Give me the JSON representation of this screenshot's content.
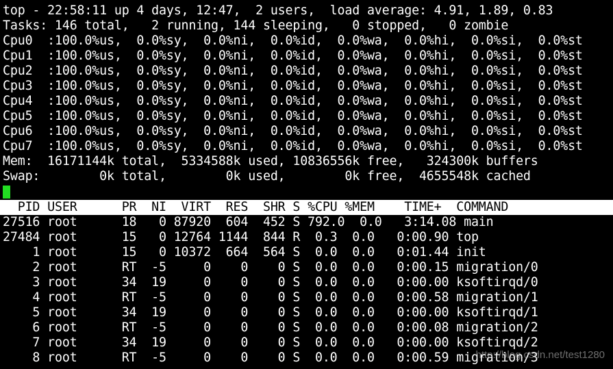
{
  "summary": {
    "uptime": "top - 22:58:11 up 4 days, 12:47,  2 users,  load average: 4.91, 1.89, 0.83",
    "tasks": "Tasks: 146 total,   2 running, 144 sleeping,   0 stopped,   0 zombie",
    "cpus": [
      "Cpu0  :100.0%us,  0.0%sy,  0.0%ni,  0.0%id,  0.0%wa,  0.0%hi,  0.0%si,  0.0%st",
      "Cpu1  :100.0%us,  0.0%sy,  0.0%ni,  0.0%id,  0.0%wa,  0.0%hi,  0.0%si,  0.0%st",
      "Cpu2  :100.0%us,  0.0%sy,  0.0%ni,  0.0%id,  0.0%wa,  0.0%hi,  0.0%si,  0.0%st",
      "Cpu3  :100.0%us,  0.0%sy,  0.0%ni,  0.0%id,  0.0%wa,  0.0%hi,  0.0%si,  0.0%st",
      "Cpu4  :100.0%us,  0.0%sy,  0.0%ni,  0.0%id,  0.0%wa,  0.0%hi,  0.0%si,  0.0%st",
      "Cpu5  :100.0%us,  0.0%sy,  0.0%ni,  0.0%id,  0.0%wa,  0.0%hi,  0.0%si,  0.0%st",
      "Cpu6  :100.0%us,  0.0%sy,  0.0%ni,  0.0%id,  0.0%wa,  0.0%hi,  0.0%si,  0.0%st",
      "Cpu7  :100.0%us,  0.0%sy,  0.0%ni,  0.0%id,  0.0%wa,  0.0%hi,  0.0%si,  0.0%st"
    ],
    "mem": "Mem:  16171144k total,  5334588k used, 10836556k free,   324300k buffers",
    "swap": "Swap:        0k total,        0k used,        0k free,  4655548k cached"
  },
  "process_table": {
    "header": "  PID USER      PR  NI  VIRT  RES  SHR S %CPU %MEM    TIME+  COMMAND",
    "rows": [
      "27516 root      18   0 87920  604  452 S 792.0  0.0   3:14.08 main",
      "27484 root      15   0 12764 1144  844 R  0.3  0.0   0:00.90 top",
      "    1 root      15   0 10372  664  564 S  0.0  0.0   0:01.44 init",
      "    2 root      RT  -5     0    0    0 S  0.0  0.0   0:00.15 migration/0",
      "    3 root      34  19     0    0    0 S  0.0  0.0   0:00.00 ksoftirqd/0",
      "    4 root      RT  -5     0    0    0 S  0.0  0.0   0:00.58 migration/1",
      "    5 root      34  19     0    0    0 S  0.0  0.0   0:00.00 ksoftirqd/1",
      "    6 root      RT  -5     0    0    0 S  0.0  0.0   0:00.08 migration/2",
      "    7 root      34  19     0    0    0 S  0.0  0.0   0:00.00 ksoftirqd/2",
      "    8 root      RT  -5     0    0    0 S  0.0  0.0   0:00.59 migration/3"
    ]
  },
  "watermark": "http://blog.csdn.net/test1280",
  "colors": {
    "background": "#000000",
    "foreground": "#ffffff",
    "header_bar": "#ffffff",
    "cursor": "#22dd22"
  }
}
